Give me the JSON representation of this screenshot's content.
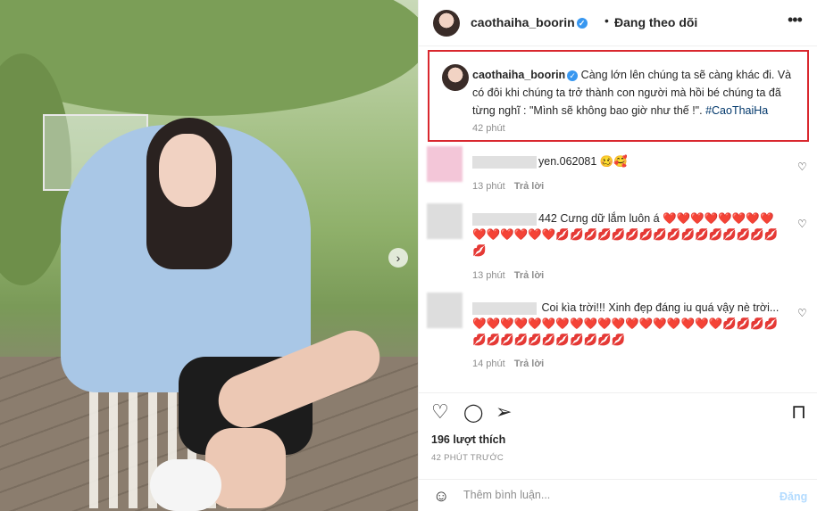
{
  "post": {
    "username": "caothaiha_boorin",
    "follow_separator": "•",
    "follow_status": "Đang theo dõi",
    "more_icon": "•••"
  },
  "caption": {
    "username": "caothaiha_boorin",
    "text": "Càng lớn lên chúng ta sẽ càng khác đi. Và có đôi khi chúng ta trở thành con người mà hồi bé chúng ta đã từng nghĩ : \"Mình sẽ không bao giờ như thế !\".",
    "hashtag": "#CaoThaiHa",
    "time": "42 phút"
  },
  "comments": [
    {
      "name_suffix": "yen.062081",
      "text": "🥴🥰",
      "time": "13 phút",
      "reply": "Trả lời"
    },
    {
      "name_suffix": "442",
      "text": "Cưng dữ lắm luôn á ❤️❤️❤️❤️❤️❤️❤️❤️❤️❤️❤️❤️❤️❤️💋💋💋💋💋💋💋💋💋💋💋💋💋💋💋💋💋",
      "time": "13 phút",
      "reply": "Trả lời"
    },
    {
      "name_suffix": "",
      "text": "Coi kìa trời!!! Xinh đẹp đáng iu quá vậy nè trời... ❤️❤️❤️❤️❤️❤️❤️❤️❤️❤️❤️❤️❤️❤️❤️❤️❤️❤️💋💋💋💋💋💋💋💋💋💋💋💋💋💋💋",
      "time": "14 phút",
      "reply": "Trả lời"
    }
  ],
  "actions": {
    "like_icon": "♡",
    "comment_icon": "◯",
    "share_icon": "➢",
    "save_icon": "⊓"
  },
  "likes": "196 lượt thích",
  "posted_time": "42 PHÚT TRƯỚC",
  "add_comment": {
    "emoji_icon": "☺",
    "placeholder": "Thêm bình luận...",
    "post_label": "Đăng"
  },
  "colors": {
    "highlight_border": "#d9272e",
    "hashtag": "#00376b",
    "verified": "#3897f0",
    "post_disabled": "#b3dbff"
  }
}
